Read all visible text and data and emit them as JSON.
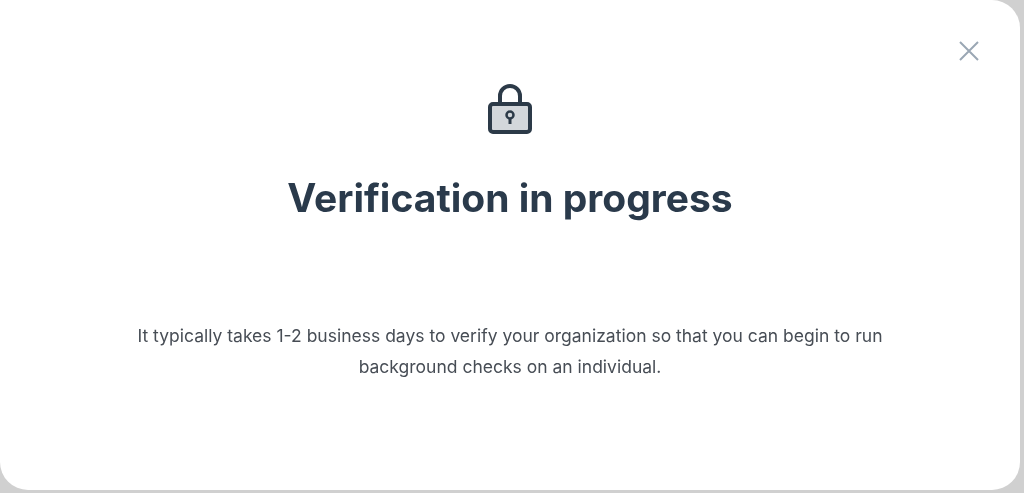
{
  "dialog": {
    "title": "Verification in progress",
    "message": "It typically takes 1-2 business days to verify your organization so that you can begin to run background checks on an individual."
  }
}
